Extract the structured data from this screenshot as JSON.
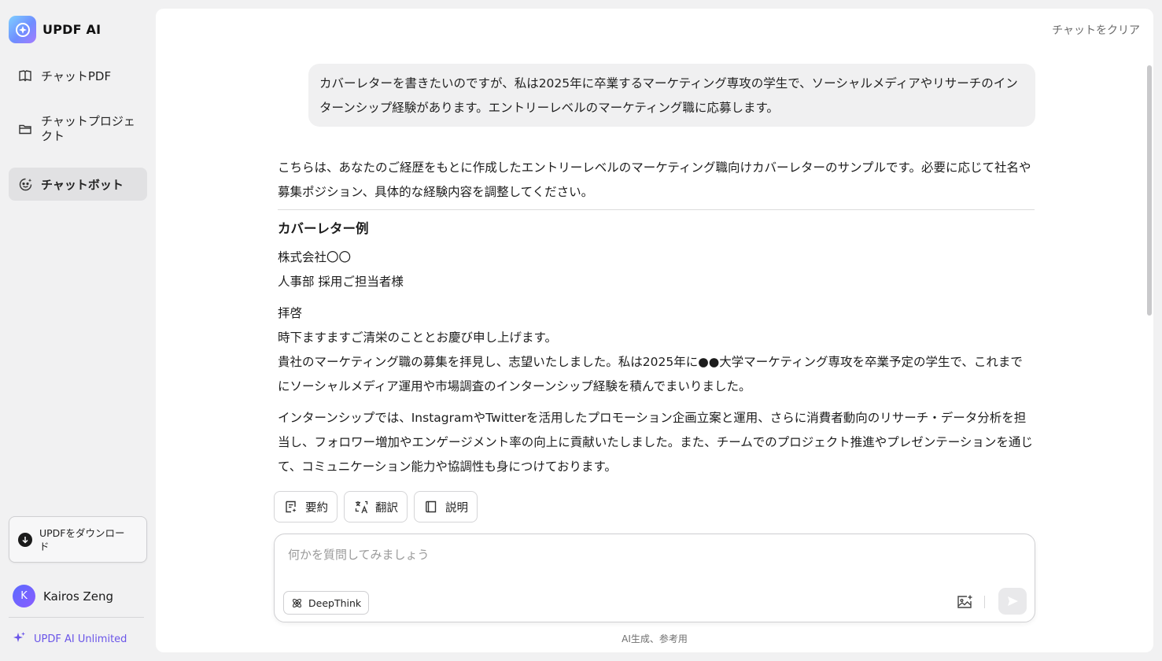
{
  "brand": {
    "name": "UPDF AI",
    "icon": "updf-ai-logo-icon"
  },
  "sidebar": {
    "items": [
      {
        "label": "チャットPDF",
        "icon": "book-icon",
        "active": false
      },
      {
        "label": "チャットプロジェクト",
        "icon": "folder-icon",
        "active": false
      },
      {
        "label": "チャットボット",
        "icon": "bot-face-icon",
        "active": true
      }
    ],
    "download_label": "UPDFをダウンロード",
    "user": {
      "initial": "K",
      "name": "Kairos Zeng"
    },
    "plan_label": "UPDF AI Unlimited"
  },
  "header": {
    "clear_label": "チャットをクリア"
  },
  "conversation": {
    "user_message": "カバーレターを書きたいのですが、私は2025年に卒業するマーケティング専攻の学生で、ソーシャルメディアやリサーチのインターンシップ経験があります。エントリーレベルのマーケティング職に応募します。",
    "answer": {
      "intro": "こちらは、あなたのご経歴をもとに作成したエントリーレベルのマーケティング職向けカバーレターのサンプルです。必要に応じて社名や募集ポジション、具体的な経験内容を調整してください。",
      "title": "カバーレター例",
      "company": "株式会社〇〇",
      "recipient": "人事部 採用ご担当者様",
      "greeting": "拝啓",
      "seasonal": "時下ますますご清栄のこととお慶び申し上げます。",
      "paragraph1": "貴社のマーケティング職の募集を拝見し、志望いたしました。私は2025年に●●大学マーケティング専攻を卒業予定の学生で、これまでにソーシャルメディア運用や市場調査のインターンシップ経験を積んでまいりました。",
      "paragraph2": "インターンシップでは、InstagramやTwitterを活用したプロモーション企画立案と運用、さらに消費者動向のリサーチ・データ分析を担当し、フォロワー増加やエンゲージメント率の向上に貢献いたしました。また、チームでのプロジェクト推進やプレゼンテーションを通じて、コミュニケーション能力や協調性も身につけております。"
    },
    "actions": [
      {
        "label": "要約",
        "icon": "summary-icon"
      },
      {
        "label": "翻訳",
        "icon": "translate-icon"
      },
      {
        "label": "説明",
        "icon": "explain-book-icon"
      }
    ]
  },
  "composer": {
    "placeholder": "何かを質問してみましょう",
    "value": "",
    "deepthink_label": "DeepThink",
    "image_icon": "image-upload-icon",
    "send_icon": "send-icon"
  },
  "footer": {
    "disclaimer": "AI生成、参考用"
  },
  "colors": {
    "accent": "#6a55e8",
    "active_bg": "#e1e1e3",
    "panel_bg": "#ffffff",
    "app_bg": "#f1f1f2"
  }
}
